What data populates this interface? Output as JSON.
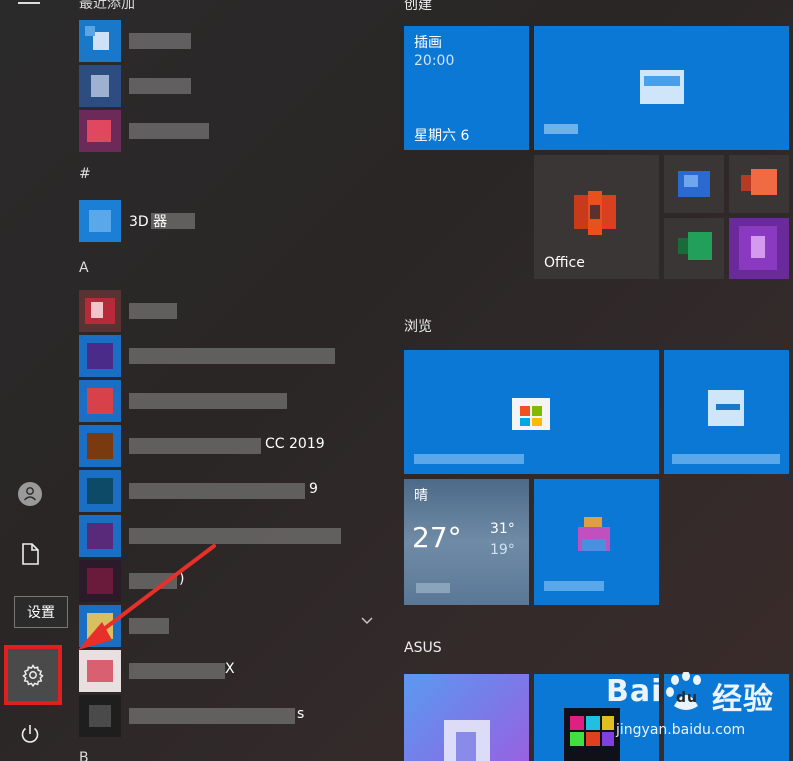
{
  "tooltip": "设置",
  "list": {
    "recent_header": "最近添加",
    "section_hash": "#",
    "section_a": "A",
    "section_b": "B",
    "apps": [
      {
        "label": "",
        "icon": "app-icon"
      },
      {
        "label": "",
        "icon": "app-icon"
      },
      {
        "label": "",
        "icon": "app-icon"
      },
      {
        "label": "3D 器",
        "icon": "app-icon"
      },
      {
        "label": "",
        "icon": "access-icon"
      },
      {
        "label": "",
        "icon": "app-icon"
      },
      {
        "label": "",
        "icon": "app-icon"
      },
      {
        "label": "CC 2019",
        "icon": "app-icon"
      },
      {
        "label": "9",
        "icon": "app-icon"
      },
      {
        "label": "",
        "icon": "app-icon"
      },
      {
        "label": ")",
        "icon": "app-icon"
      },
      {
        "label": "",
        "icon": "app-icon"
      },
      {
        "label": "X",
        "icon": "app-icon"
      },
      {
        "label": "s",
        "icon": "app-icon"
      }
    ]
  },
  "tiles": {
    "group_create": "创建",
    "group_browse": "浏览",
    "group_asus": "ASUS",
    "calendar": {
      "title": "插画",
      "time": "20:00",
      "day": "星期六 6"
    },
    "office": {
      "label": "Office"
    },
    "weather": {
      "condition": "晴",
      "temp": "27°",
      "high": "31°",
      "low": "19°"
    }
  },
  "watermark": {
    "main": "Bai",
    "mid": "du",
    "cn": "经验",
    "url": "jingyan.baidu.com"
  },
  "colors": {
    "tile_blue": "#0a78d4",
    "highlight_red": "#e02020"
  }
}
